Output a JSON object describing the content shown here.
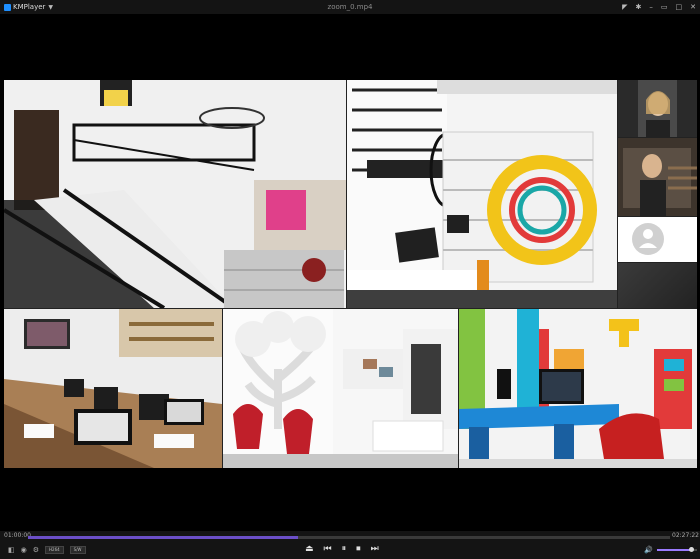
{
  "app": {
    "name": "KMPlayer",
    "file_name": "zoom_0.mp4"
  },
  "window_controls": [
    {
      "name": "pin-icon",
      "glyph": "◤"
    },
    {
      "name": "settings-icon",
      "glyph": "✱"
    },
    {
      "name": "minimize-icon",
      "glyph": "–"
    },
    {
      "name": "restore-icon",
      "glyph": "▭"
    },
    {
      "name": "maximize-icon",
      "glyph": "□"
    },
    {
      "name": "close-icon",
      "glyph": "✕"
    }
  ],
  "playback": {
    "current_time": "01:00:00",
    "total_time": "02:27:22",
    "progress": 0.42,
    "volume": 0.85
  },
  "left_controls": {
    "chip_1": "H264",
    "chip_2": "S/W"
  },
  "icons": {
    "left_1": "◧",
    "left_2": "◉",
    "left_3": "⚙",
    "volume": "🔊"
  },
  "buttons": {
    "eject": "⏏",
    "prev": "⏮",
    "pause": "⏸",
    "stop": "⏹",
    "next": "⏭"
  }
}
